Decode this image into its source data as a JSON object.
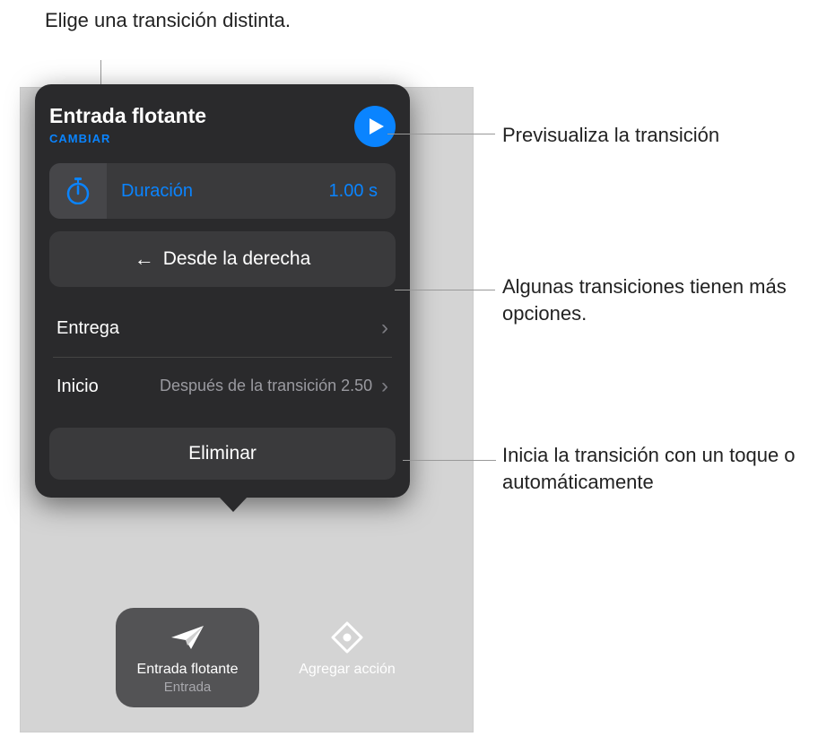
{
  "callouts": {
    "top": "Elige una transición distinta.",
    "preview": "Previsualiza la transición",
    "options": "Algunas transiciones tienen más opciones.",
    "start": "Inicia la transición con un toque o automáticamente"
  },
  "popover": {
    "title": "Entrada flotante",
    "change": "CAMBIAR",
    "duration": {
      "label": "Duración",
      "value": "1.00 s"
    },
    "direction": "Desde la derecha",
    "delivery": {
      "label": "Entrega"
    },
    "start": {
      "label": "Inicio",
      "value": "Después de la transición  2.50"
    },
    "delete": "Eliminar"
  },
  "actions": {
    "build": {
      "title": "Entrada flotante",
      "subtitle": "Entrada"
    },
    "add": {
      "title": "Agregar acción"
    }
  }
}
